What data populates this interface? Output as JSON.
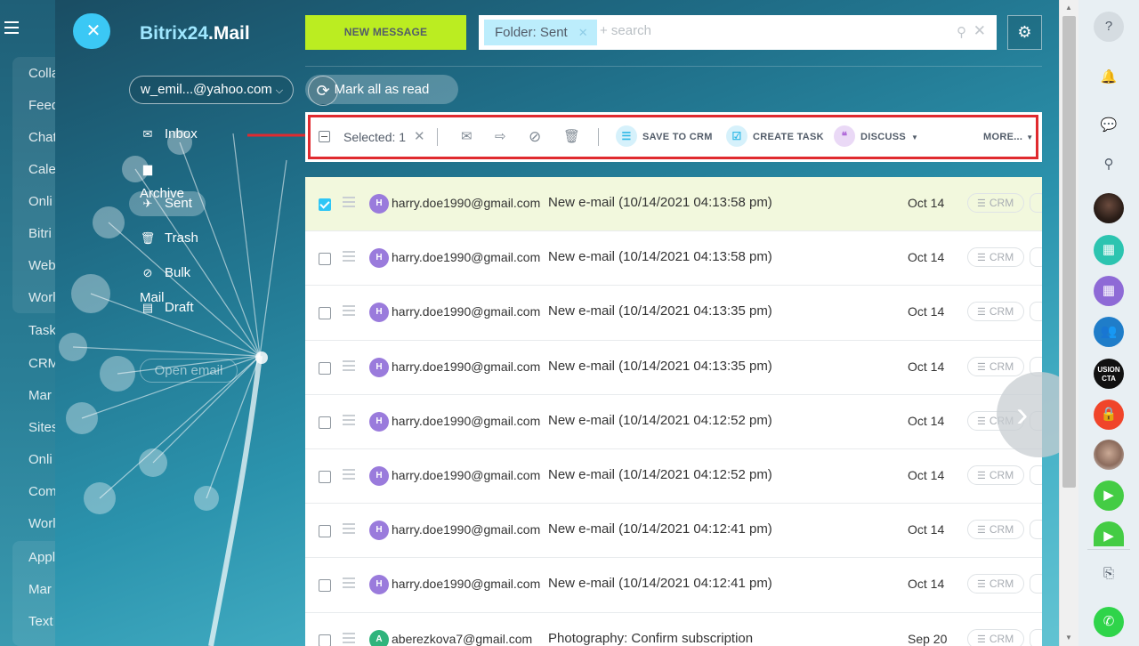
{
  "background_nav": {
    "items": [
      "Colla",
      "Feed",
      "Chat",
      "Cale",
      "Onli",
      "Bitri",
      "Web",
      "Worl",
      "Task",
      "CRM",
      "Mar",
      "Sites",
      "Onli",
      "Com",
      "Worl",
      "Appl",
      "Mar",
      "Text"
    ]
  },
  "header": {
    "logo_brand": "Bitrix24",
    "logo_product": ".Mail",
    "account": "w_emil...@yahoo.com",
    "new_message": "NEW MESSAGE",
    "search": {
      "chip_label": "Folder: Sent",
      "placeholder": "+ search"
    }
  },
  "folders": [
    {
      "label": "Inbox",
      "icon": "envelope-icon",
      "glyph": "✉"
    },
    {
      "label": "Archive",
      "icon": "folder-icon",
      "glyph": "▆"
    },
    {
      "label": "Sent",
      "icon": "sent-icon",
      "glyph": "✈",
      "active": true
    },
    {
      "label": "Trash",
      "icon": "trash-icon",
      "glyph": "🗑"
    },
    {
      "label": "Bulk Mail",
      "icon": "block-icon",
      "glyph": "⊘"
    },
    {
      "label": "Draft",
      "icon": "document-icon",
      "glyph": "▤"
    }
  ],
  "open_email": "Open email",
  "mark_all_read": "Mark all as read",
  "toolbar": {
    "selected": "Selected: 1",
    "save_to_crm": "SAVE TO CRM",
    "create_task": "CREATE TASK",
    "discuss": "DISCUSS",
    "more": "MORE..."
  },
  "messages": [
    {
      "avatar": "H",
      "avatar_color": "#9a7bdc",
      "from": "harry.doe1990@gmail.com",
      "subject": "New e-mail (10/14/2021 04:13:58 pm)",
      "date": "Oct 14",
      "crm": "CRM",
      "selected": true
    },
    {
      "avatar": "H",
      "avatar_color": "#9a7bdc",
      "from": "harry.doe1990@gmail.com",
      "subject": "New e-mail (10/14/2021 04:13:58 pm)",
      "date": "Oct 14",
      "crm": "CRM",
      "selected": false
    },
    {
      "avatar": "H",
      "avatar_color": "#9a7bdc",
      "from": "harry.doe1990@gmail.com",
      "subject": "New e-mail (10/14/2021 04:13:35 pm)",
      "date": "Oct 14",
      "crm": "CRM",
      "selected": false
    },
    {
      "avatar": "H",
      "avatar_color": "#9a7bdc",
      "from": "harry.doe1990@gmail.com",
      "subject": "New e-mail (10/14/2021 04:13:35 pm)",
      "date": "Oct 14",
      "crm": "CRM",
      "selected": false
    },
    {
      "avatar": "H",
      "avatar_color": "#9a7bdc",
      "from": "harry.doe1990@gmail.com",
      "subject": "New e-mail (10/14/2021 04:12:52 pm)",
      "date": "Oct 14",
      "crm": "CRM",
      "selected": false
    },
    {
      "avatar": "H",
      "avatar_color": "#9a7bdc",
      "from": "harry.doe1990@gmail.com",
      "subject": "New e-mail (10/14/2021 04:12:52 pm)",
      "date": "Oct 14",
      "crm": "CRM",
      "selected": false
    },
    {
      "avatar": "H",
      "avatar_color": "#9a7bdc",
      "from": "harry.doe1990@gmail.com",
      "subject": "New e-mail (10/14/2021 04:12:41 pm)",
      "date": "Oct 14",
      "crm": "CRM",
      "selected": false
    },
    {
      "avatar": "H",
      "avatar_color": "#9a7bdc",
      "from": "harry.doe1990@gmail.com",
      "subject": "New e-mail (10/14/2021 04:12:41 pm)",
      "date": "Oct 14",
      "crm": "CRM",
      "selected": false
    },
    {
      "avatar": "A",
      "avatar_color": "#2fb47c",
      "from": "aberezkova7@gmail.com",
      "subject": "Photography: Confirm subscription",
      "date": "Sep 20",
      "crm": "CRM",
      "selected": false
    }
  ],
  "right_bar": {
    "fusion_label": "USION CTA"
  },
  "colors": {
    "accent_green": "#bbed21",
    "accent_blue": "#3bc8f5",
    "highlight_red": "#e02a2f",
    "selected_row": "#f2f8dd"
  }
}
